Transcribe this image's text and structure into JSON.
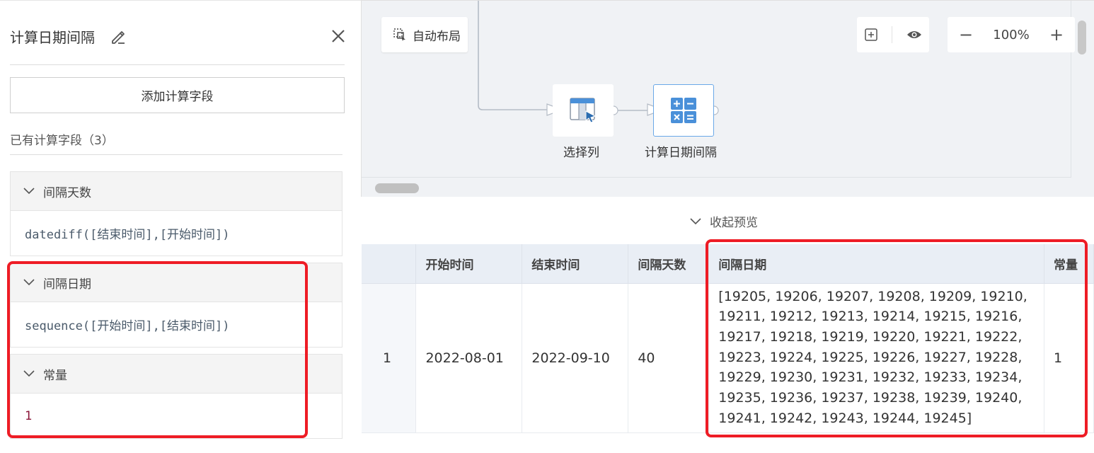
{
  "left_panel": {
    "title": "计算日期间隔",
    "add_button": "添加计算字段",
    "existing_label": "已有计算字段（3）",
    "fields": [
      {
        "name": "间隔天数",
        "expr": "datediff([结束时间],[开始时间])"
      },
      {
        "name": "间隔日期",
        "expr": "sequence([开始时间],[结束时间])"
      },
      {
        "name": "常量",
        "expr": "1"
      }
    ]
  },
  "canvas": {
    "auto_layout": "自动布局",
    "zoom": "100%",
    "nodes": [
      {
        "label": "选择列"
      },
      {
        "label": "计算日期间隔"
      }
    ]
  },
  "preview": {
    "collapse_label": "收起预览",
    "columns": [
      "",
      "开始时间",
      "结束时间",
      "间隔天数",
      "间隔日期",
      "常量"
    ],
    "rows": [
      {
        "index": "1",
        "start": "2022-08-01",
        "end": "2022-09-10",
        "days": "40",
        "interval_lines": [
          "[19205, 19206, 19207, 19208, 19209, 19210,",
          "19211, 19212, 19213, 19214, 19215, 19216,",
          "19217, 19218, 19219, 19220, 19221, 19222,",
          "19223, 19224, 19225, 19226, 19227, 19228,",
          "19229, 19230, 19231, 19232, 19233, 19234,",
          "19235, 19236, 19237, 19238, 19239, 19240,",
          "19241, 19242, 19243, 19244, 19245]"
        ],
        "constant": "1"
      }
    ]
  },
  "colors": {
    "highlight": "#ee1c25",
    "node_active_border": "#6aa8e8",
    "icon_blue": "#4a90d9"
  }
}
